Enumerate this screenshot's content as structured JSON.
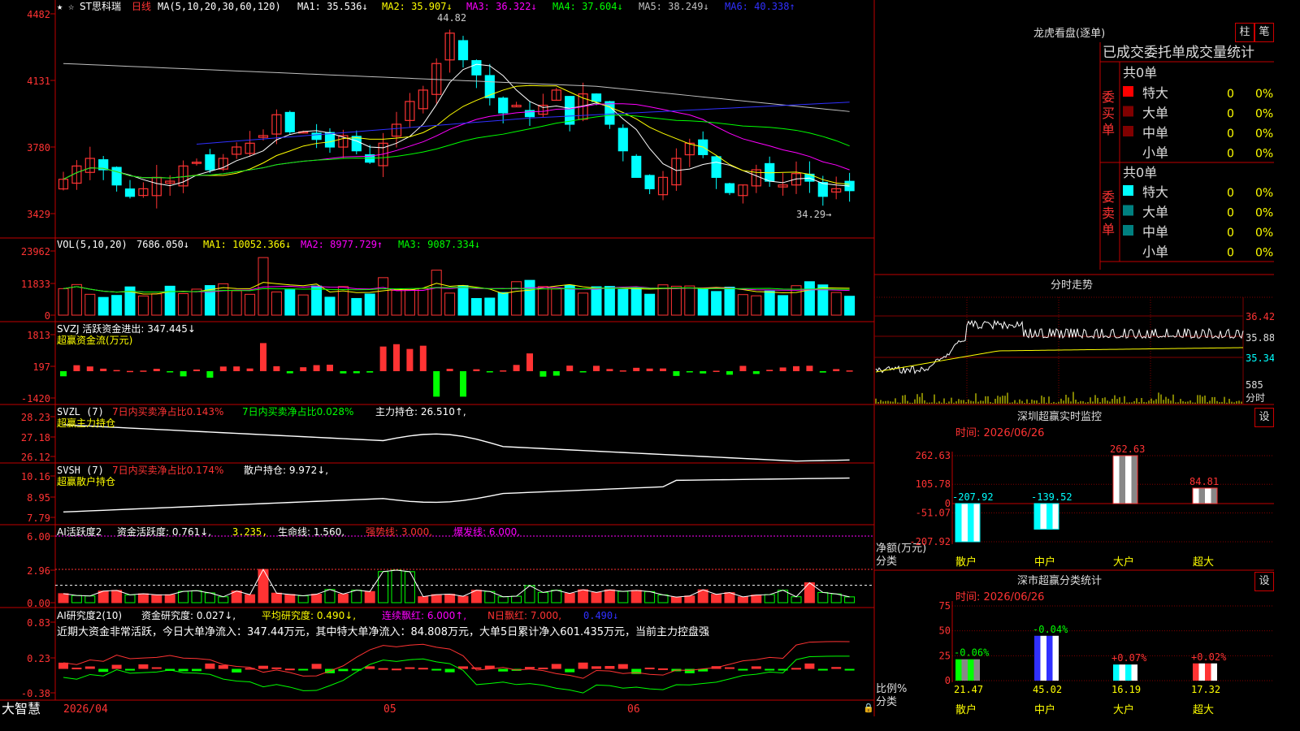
{
  "app": {
    "brand": "大智慧"
  },
  "stock": {
    "name": "ST思科瑞",
    "period": "日线"
  },
  "dates": {
    "start": "2026/04",
    "m5": "05",
    "m6": "06"
  },
  "colors": {
    "up": "#ff3333",
    "down": "#00ffff",
    "ma1": "#ffffff",
    "ma2": "#ffff00",
    "ma3": "#ff00ff",
    "ma4": "#00ff00",
    "ma5": "#c0c0c0",
    "ma6": "#3030ff",
    "grid": "#800000",
    "frame": "#c00000"
  },
  "main": {
    "ma_header": {
      "lead": "MA(5,10,20,30,60,120)",
      "ma1": "MA1: 35.536↓",
      "ma2": "MA2: 35.907↓",
      "ma3": "MA3: 36.322↓",
      "ma4": "MA4: 37.604↓",
      "ma5": "MA5: 38.249↓",
      "ma6": "MA6: 40.338↑"
    },
    "y_ticks": [
      "4482",
      "4131",
      "3780",
      "3429"
    ],
    "high_label": "44.82",
    "low_label": "34.29→"
  },
  "vol": {
    "header": {
      "lead": "VOL(5,10,20)",
      "v": "7686.050↓",
      "ma1": "MA1: 10052.366↓",
      "ma2": "MA2: 8977.729↑",
      "ma3": "MA3: 9087.334↓"
    },
    "y_ticks": [
      "23962",
      "11833",
      "0"
    ]
  },
  "svzj": {
    "header1": "SVZJ  活跃资金进出: 347.445↓",
    "header2": "超赢资金流(万元)",
    "y_ticks": [
      "1813",
      "197",
      "-1420"
    ]
  },
  "svzl": {
    "lead": "SVZL (7)",
    "a": "7日内买卖净占比0.143%",
    "b": "7日内买卖净占比0.028%",
    "c": "主力持仓: 26.510↑,",
    "header2": "超赢主力持仓",
    "y_ticks": [
      "28.23",
      "27.18",
      "26.12"
    ]
  },
  "svsh": {
    "lead": "SVSH (7)",
    "a": "7日内买卖净占比0.174%",
    "c": "散户持仓: 9.972↓,",
    "header2": "超赢散户持仓",
    "y_ticks": [
      "10.16",
      "8.95",
      "7.79"
    ]
  },
  "ai1": {
    "lead": "AI活跃度2",
    "a": "资金活跃度: 0.761↓,",
    "b": "3.235,",
    "c": "生命线: 1.560,",
    "d": "强势线: 3.000,",
    "e": "爆发线: 6.000,",
    "y_ticks": [
      "6.00",
      "2.96",
      "0.00"
    ]
  },
  "ai2": {
    "lead": "AI研究度2(10)",
    "a": "资金研究度: 0.027↓,",
    "b": "平均研究度: 0.490↓,",
    "c": "连续飘红: 6.000↑,",
    "d": "N日飘红: 7.000,",
    "e": "0.490↓",
    "summary": "近期大资金非常活跃，今日大单净流入：347.44万元，其中特大单净流入：84.808万元，大单5日累计净入601.435万元，当前主力控盘强",
    "y_ticks": [
      "0.83",
      "0.23",
      "-0.38"
    ]
  },
  "lhb": {
    "title": "龙虎看盘(逐单)",
    "btn1": "柱",
    "btn2": "笔",
    "subtitle": "已成交委托单成交量统计",
    "buy": {
      "side": "委买单",
      "total": "共0单",
      "rows": [
        {
          "label": "特大",
          "v": "0",
          "p": "0%"
        },
        {
          "label": "大单",
          "v": "0",
          "p": "0%"
        },
        {
          "label": "中单",
          "v": "0",
          "p": "0%"
        },
        {
          "label": "小单",
          "v": "0",
          "p": "0%"
        }
      ]
    },
    "sell": {
      "side": "委卖单",
      "total": "共0单",
      "rows": [
        {
          "label": "特大",
          "v": "0",
          "p": "0%"
        },
        {
          "label": "大单",
          "v": "0",
          "p": "0%"
        },
        {
          "label": "中单",
          "v": "0",
          "p": "0%"
        },
        {
          "label": "小单",
          "v": "0",
          "p": "0%"
        }
      ]
    }
  },
  "intraday": {
    "title": "分时走势",
    "y_ticks": [
      "36.42",
      "35.88",
      "35.34"
    ],
    "vol_label": "585",
    "vol_unit": "分时"
  },
  "sz_monitor": {
    "title": "深圳超赢实时监控",
    "btn": "设",
    "time": "时间: 2026/06/26",
    "y_ticks": [
      "262.63",
      "105.78",
      "0",
      "-51.07",
      "-207.92"
    ],
    "ylabel1": "净额(万元)",
    "ylabel2": "分类"
  },
  "sz_stats": {
    "title": "深市超赢分类统计",
    "btn": "设",
    "time": "时间: 2026/06/26",
    "y_ticks": [
      "75",
      "50",
      "25",
      "0"
    ],
    "ylabel1": "比例%",
    "ylabel2": "分类"
  },
  "chart_data": [
    {
      "type": "bar",
      "title": "深圳超赢实时监控",
      "ylabel": "净额(万元)",
      "categories": [
        "散户",
        "中户",
        "大户",
        "超大"
      ],
      "values": [
        -207.92,
        -139.52,
        262.63,
        84.81
      ],
      "ylim": [
        -207.92,
        262.63
      ]
    },
    {
      "type": "bar",
      "title": "深市超赢分类统计",
      "ylabel": "比例%",
      "categories": [
        "散户",
        "中户",
        "大户",
        "超大"
      ],
      "values": [
        21.47,
        45.02,
        16.19,
        17.32
      ],
      "change_labels": [
        "-0.06%",
        "-0.04%",
        "+0.07%",
        "+0.02%"
      ],
      "ylim": [
        0,
        75
      ]
    }
  ]
}
